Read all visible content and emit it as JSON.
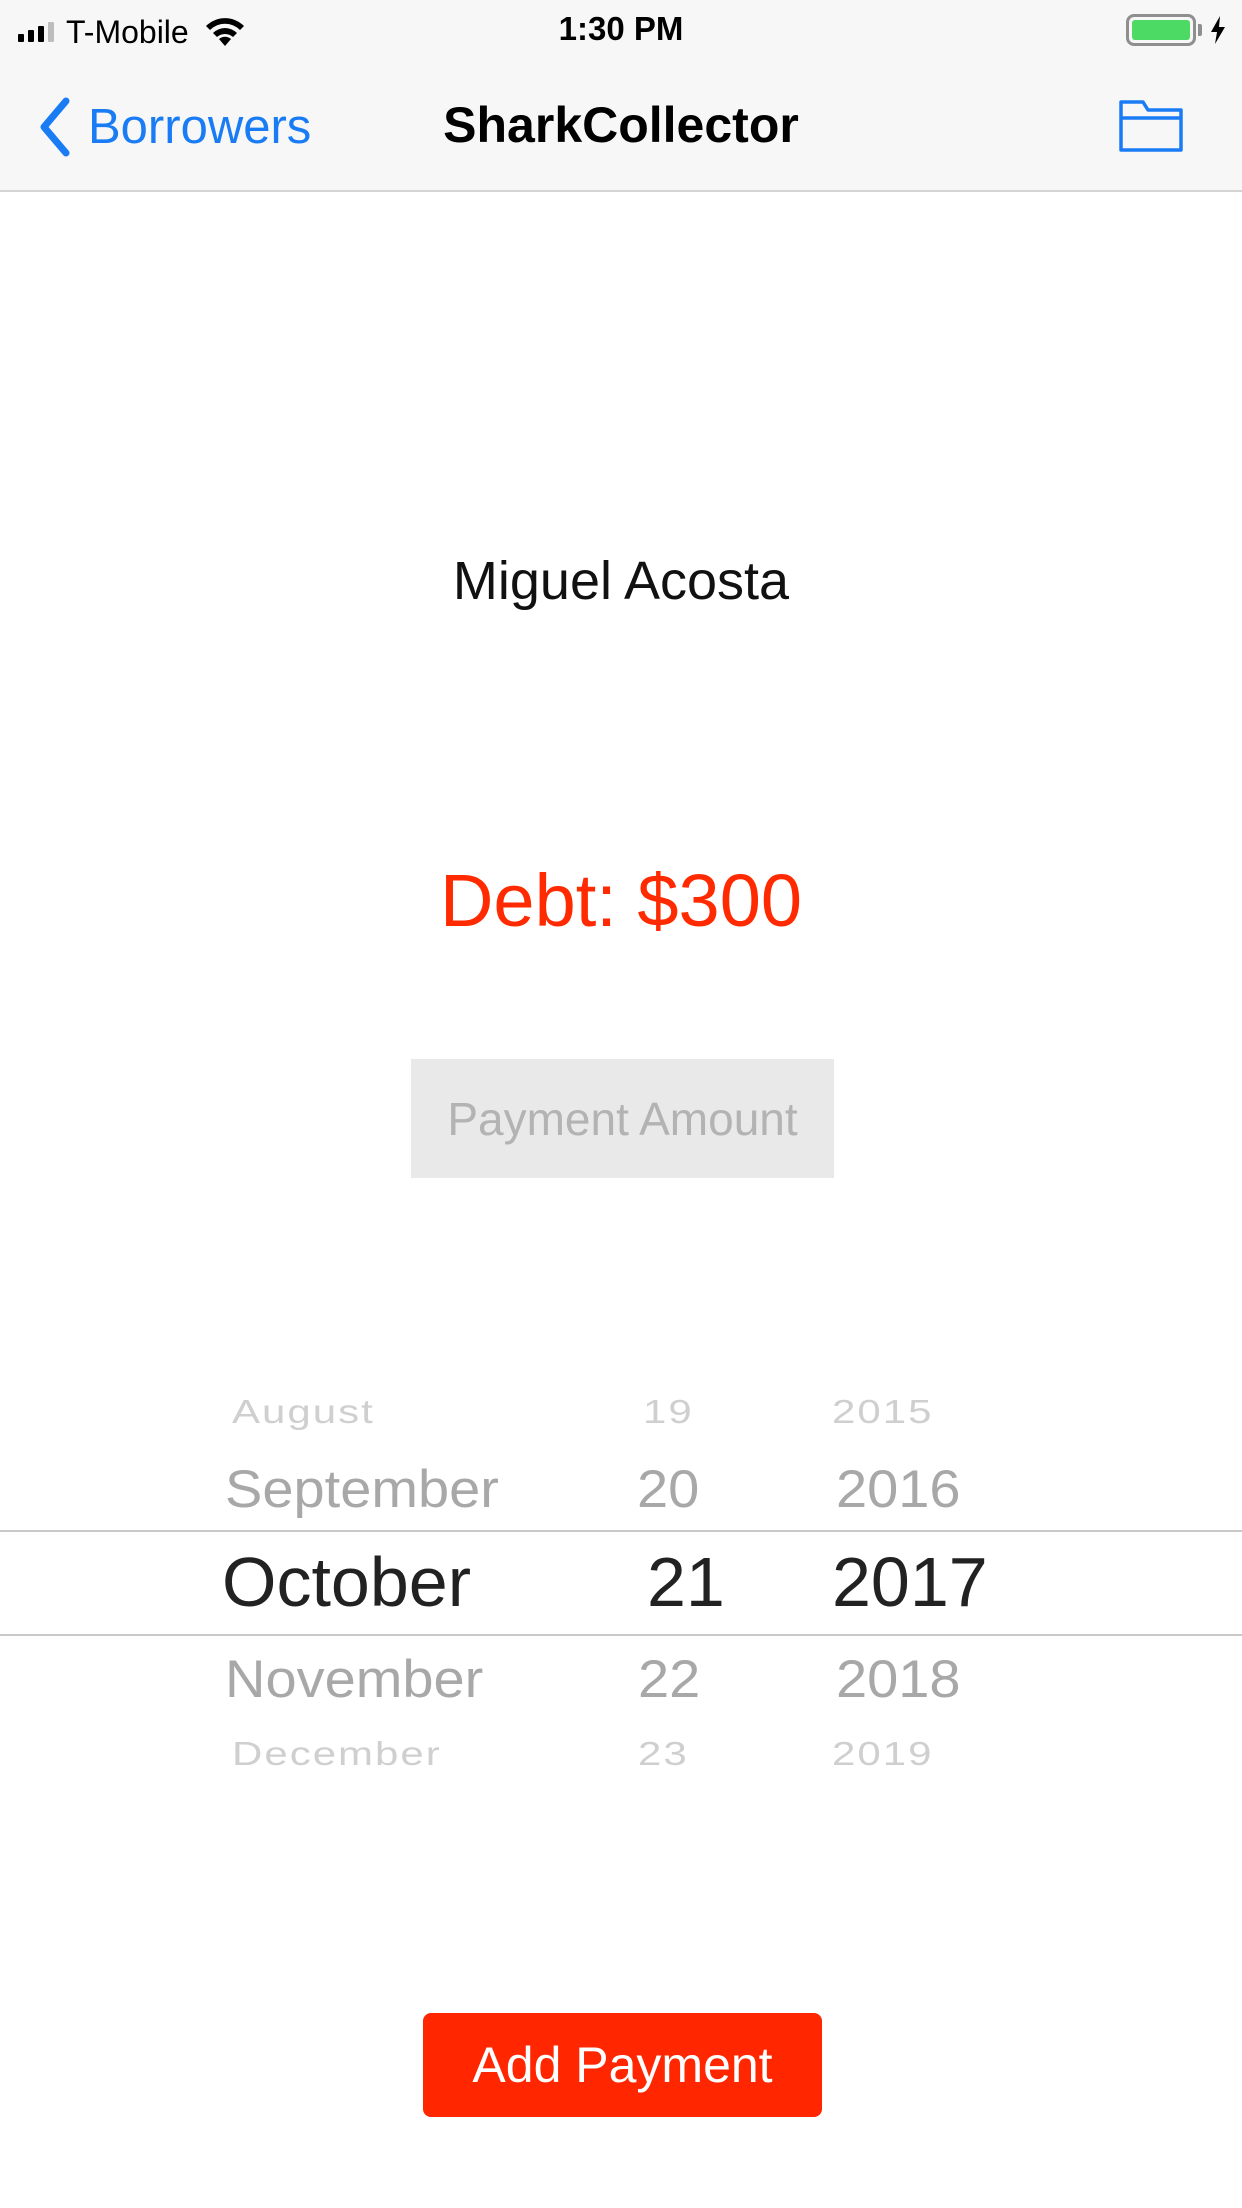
{
  "status_bar": {
    "carrier": "T-Mobile",
    "time": "1:30 PM",
    "battery_color": "#4cd964"
  },
  "nav": {
    "back_label": "Borrowers",
    "title": "SharkCollector",
    "right_icon": "folder-icon",
    "tint_color": "#1a7cf5"
  },
  "borrower": {
    "name": "Miguel Acosta",
    "debt_text": "Debt: $300",
    "debt_color": "#ff2a00"
  },
  "payment_field": {
    "placeholder": "Payment Amount",
    "value": ""
  },
  "date_picker": {
    "months": [
      "August",
      "September",
      "October",
      "November",
      "December"
    ],
    "days": [
      "19",
      "20",
      "21",
      "22",
      "23"
    ],
    "years": [
      "2015",
      "2016",
      "2017",
      "2018",
      "2019"
    ],
    "selected": {
      "month": "October",
      "day": "21",
      "year": "2017"
    }
  },
  "add_button": {
    "label": "Add Payment",
    "color": "#ff2600"
  }
}
